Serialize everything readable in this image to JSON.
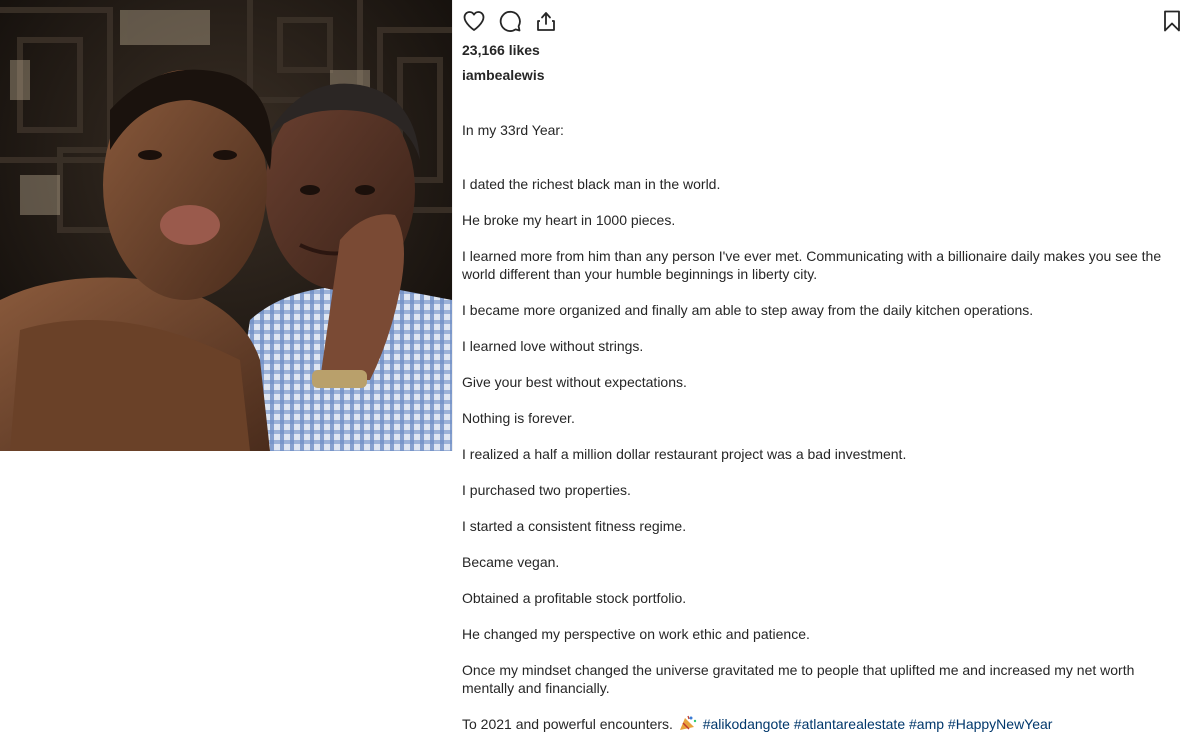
{
  "post": {
    "likes": "23,166 likes",
    "username": "iambealewis",
    "caption_intro": "In my 33rd Year:",
    "caption_lines": [
      "I dated the richest black man in the world.",
      "He broke my heart in 1000 pieces.",
      "I learned more from him than any person I've ever met. Communicating with a billionaire daily makes you see the world different than your humble beginnings in liberty city.",
      "I became more organized and finally am able to step away from the daily kitchen operations.",
      "I learned love without strings.",
      "Give your best without expectations.",
      "Nothing is forever.",
      "I realized a half a million dollar restaurant project was a bad investment.",
      "I purchased two properties.",
      "I started a consistent fitness regime.",
      "Became vegan.",
      "Obtained a profitable stock portfolio.",
      "He changed my perspective on work ethic and patience.",
      "Once my mindset changed the universe gravitated me to people that uplifted me and increased my net worth mentally and financially."
    ],
    "caption_last": "To 2021 and powerful encounters.",
    "emoji": "party-popper-icon",
    "hashtags": [
      "#alikodangote",
      "#atlantarealestate",
      "#amp",
      "#HappyNewYear"
    ]
  },
  "actions": {
    "like": "heart-icon",
    "comment": "comment-icon",
    "share": "share-icon",
    "save": "bookmark-icon"
  },
  "colors": {
    "text": "#262626",
    "hashtag": "#00376b",
    "background": "#ffffff"
  }
}
